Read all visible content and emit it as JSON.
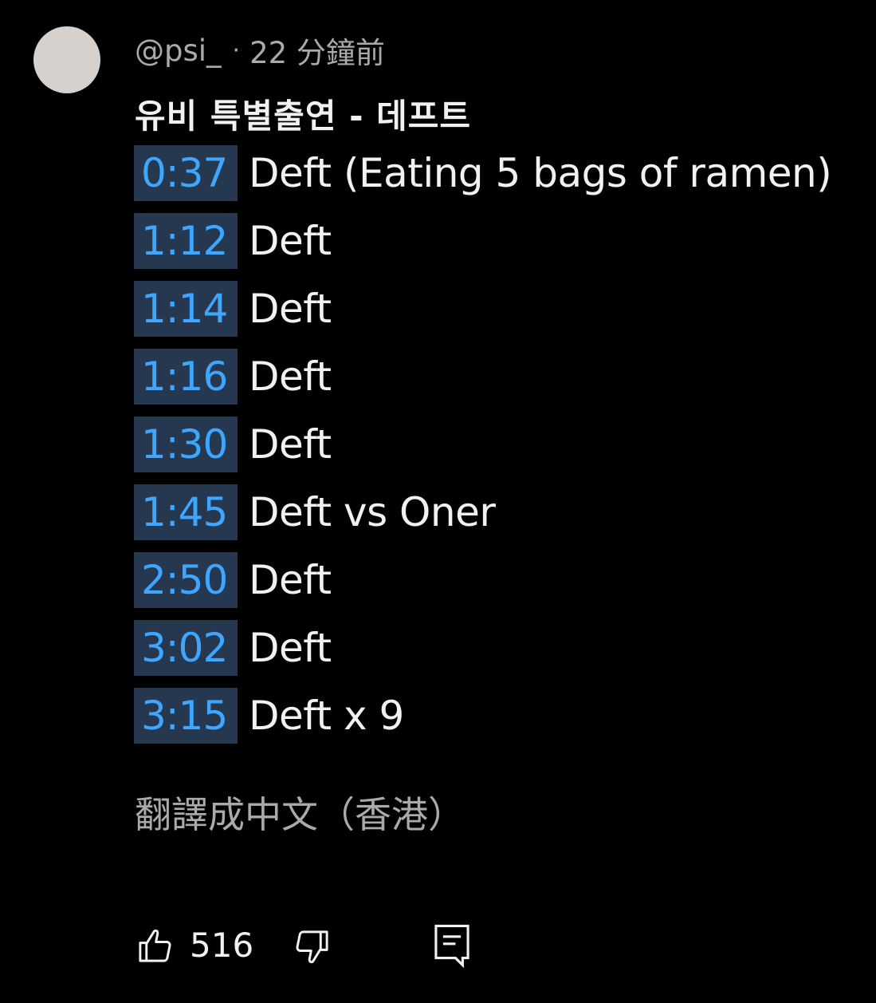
{
  "comment": {
    "author": "@psi_",
    "separator": "·",
    "time": "22 分鐘前",
    "title": "유비 특별출연 - 데프트",
    "chapters": [
      {
        "time": "0:37",
        "text": "Deft (Eating 5 bags of ramen)"
      },
      {
        "time": "1:12",
        "text": "Deft"
      },
      {
        "time": "1:14",
        "text": "Deft"
      },
      {
        "time": "1:16",
        "text": "Deft"
      },
      {
        "time": "1:30",
        "text": "Deft"
      },
      {
        "time": "1:45",
        "text": "Deft vs Oner"
      },
      {
        "time": "2:50",
        "text": "Deft"
      },
      {
        "time": "3:02",
        "text": "Deft"
      },
      {
        "time": "3:15",
        "text": "Deft x 9"
      }
    ],
    "translate_label": "翻譯成中文（香港）",
    "like_count": "516"
  },
  "icons": {
    "like": "thumbs-up-icon",
    "dislike": "thumbs-down-icon",
    "reply": "comment-reply-icon"
  },
  "colors": {
    "background": "#000000",
    "text": "#f1f1f1",
    "secondary_text": "#aaaaaa",
    "link": "#3ea6ff",
    "timestamp_bg": "#263850",
    "avatar": "#d7d1cd"
  }
}
